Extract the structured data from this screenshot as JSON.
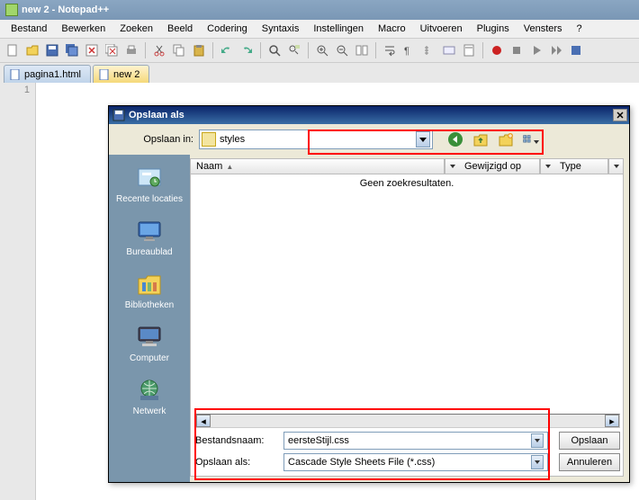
{
  "window": {
    "title": "new  2 - Notepad++"
  },
  "menu": {
    "items": [
      "Bestand",
      "Bewerken",
      "Zoeken",
      "Beeld",
      "Codering",
      "Syntaxis",
      "Instellingen",
      "Macro",
      "Uitvoeren",
      "Plugins",
      "Vensters",
      "?"
    ]
  },
  "tabs": [
    {
      "label": "pagina1.html",
      "active": false
    },
    {
      "label": "new  2",
      "active": true
    }
  ],
  "gutter": {
    "line1": "1"
  },
  "dialog": {
    "title": "Opslaan als",
    "save_in_label": "Opslaan in:",
    "save_in_value": "styles",
    "columns": {
      "name": "Naam",
      "modified": "Gewijzigd op",
      "type": "Type"
    },
    "no_results": "Geen zoekresultaten.",
    "sidebar": {
      "recent": "Recente locaties",
      "desktop": "Bureaublad",
      "libraries": "Bibliotheken",
      "computer": "Computer",
      "network": "Netwerk"
    },
    "filename_label": "Bestandsnaam:",
    "filename_value": "eersteStijl.css",
    "saveas_label": "Opslaan als:",
    "saveas_value": "Cascade Style Sheets File (*.css)",
    "save_btn": "Opslaan",
    "cancel_btn": "Annuleren"
  }
}
